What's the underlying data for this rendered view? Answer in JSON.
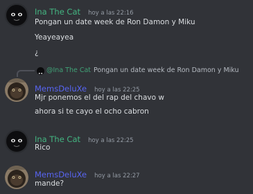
{
  "colors": {
    "ina_name": "#43b581",
    "mems_name": "#5865f2",
    "background": "#313338"
  },
  "messages": [
    {
      "author": "Ina The Cat",
      "timestamp": "hoy a las 22:16",
      "lines": [
        "Pongan un date week de Ron Damon y Miku",
        "Yeayeayea",
        "¿"
      ]
    },
    {
      "reply": {
        "author": "@Ina The Cat",
        "text": "Pongan un date week de Ron Damon y Miku"
      },
      "author": "MemsDeluXe",
      "timestamp": "hoy a las 22:25",
      "lines": [
        "Mjr ponemos el del rap del chavo w",
        "ahora si te cayo el ocho cabron"
      ]
    },
    {
      "author": "Ina The Cat",
      "timestamp": "hoy a las 22:25",
      "lines": [
        "Rico"
      ]
    },
    {
      "author": "MemsDeluXe",
      "timestamp": "hoy a las 22:27",
      "lines": [
        "mande?"
      ]
    }
  ]
}
